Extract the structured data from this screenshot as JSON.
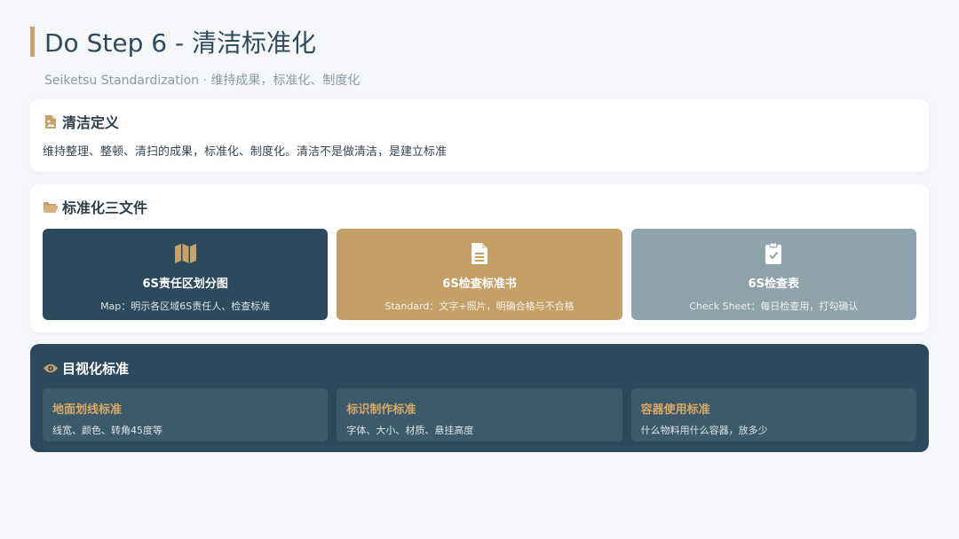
{
  "header": {
    "title": "Do Step 6 - 清洁标准化",
    "subtitle": "Seiketsu Standardization · 维持成果，标准化、制度化"
  },
  "definition": {
    "icon": "file-image-icon",
    "title": "清洁定义",
    "text": "维持整理、整顿、清扫的成果，标准化、制度化。清洁不是做清洁，是建立标准"
  },
  "documents": {
    "icon": "folder-open-icon",
    "title": "标准化三文件",
    "items": [
      {
        "icon": "map-icon",
        "title": "6S责任区划分图",
        "desc": "Map：明示各区域6S责任人、检查标准"
      },
      {
        "icon": "document-icon",
        "title": "6S检查标准书",
        "desc": "Standard：文字+照片，明确合格与不合格"
      },
      {
        "icon": "clipboard-check-icon",
        "title": "6S检查表",
        "desc": "Check Sheet：每日检查用，打勾确认"
      }
    ]
  },
  "visual": {
    "icon": "eye-icon",
    "title": "目视化标准",
    "items": [
      {
        "title": "地面划线标准",
        "desc": "线宽、颜色、转角45度等"
      },
      {
        "title": "标识制作标准",
        "desc": "字体、大小、材质、悬挂高度"
      },
      {
        "title": "容器使用标准",
        "desc": "什么物料用什么容器，放多少"
      }
    ]
  },
  "colors": {
    "accent_gold": "#c9a26a",
    "navy": "#2c4a5c",
    "gray_blue": "#8fa3ad",
    "background": "#f5f7fa"
  }
}
